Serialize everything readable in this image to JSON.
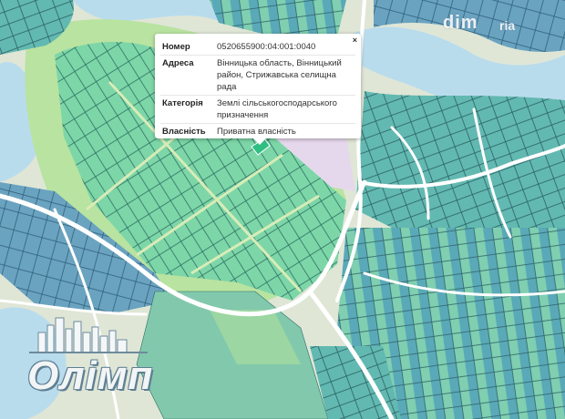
{
  "map": {
    "colors": {
      "background": "#dfe6d6",
      "water": "#b9dced",
      "parcel_green": "#7dd6a7",
      "parcel_teal": "#5fb7b4",
      "parcel_blue": "#6aa3c0",
      "parcel_border": "#2c6f65",
      "road": "#ffffff",
      "field": "#b9e3a0"
    }
  },
  "popup": {
    "close_label": "×",
    "rows": [
      {
        "key": "Номер",
        "value": "0520655900:04:001:0040"
      },
      {
        "key": "Адреса",
        "value": "Вінницька область, Вінницький район, Стрижавська селищна рада"
      },
      {
        "key": "Категорія",
        "value": "Землі сільськогосподарського призначення"
      },
      {
        "key": "Власність",
        "value": "Приватна власність"
      }
    ]
  },
  "watermarks": {
    "dim": "dim",
    "ria": "ria",
    "logo_text": "Олімп"
  }
}
